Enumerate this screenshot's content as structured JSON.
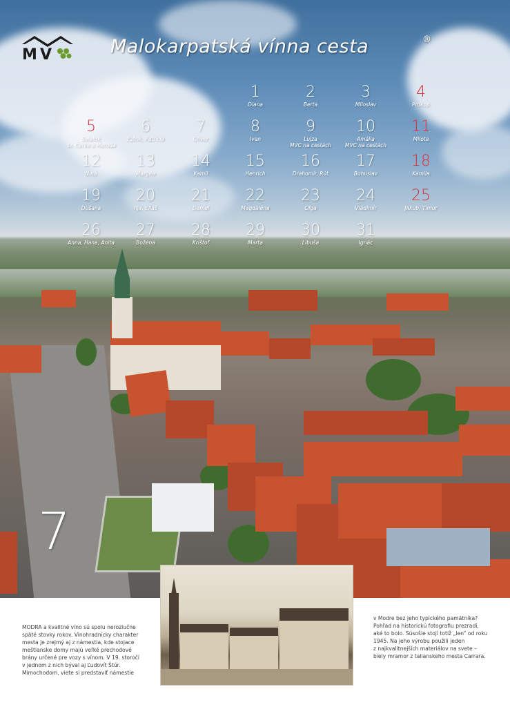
{
  "header": {
    "logo_text": "MVC",
    "title": "Malokarpatská vínna cesta",
    "registered": "®"
  },
  "calendar": {
    "month_number": "7",
    "days": [
      {
        "num": "1",
        "name": "Diana",
        "holiday": false
      },
      {
        "num": "2",
        "name": "Berta",
        "holiday": false
      },
      {
        "num": "3",
        "name": "Miloslav",
        "holiday": false
      },
      {
        "num": "4",
        "name": "Prokop",
        "holiday": true
      },
      {
        "num": "5",
        "name": "Sviatok",
        "name2": "sv. Cyrila a Metoda",
        "holiday": true
      },
      {
        "num": "6",
        "name": "Patrik, Patrícia",
        "holiday": false
      },
      {
        "num": "7",
        "name": "Oliver",
        "holiday": false
      },
      {
        "num": "8",
        "name": "Ivan",
        "holiday": false
      },
      {
        "num": "9",
        "name": "Lujza",
        "name2": "MVC na cestách",
        "holiday": false
      },
      {
        "num": "10",
        "name": "Amália",
        "name2": "MVC na cestách",
        "holiday": false
      },
      {
        "num": "11",
        "name": "Milota",
        "holiday": true
      },
      {
        "num": "12",
        "name": "Nina",
        "holiday": false
      },
      {
        "num": "13",
        "name": "Margita",
        "holiday": false
      },
      {
        "num": "14",
        "name": "Kamil",
        "holiday": false
      },
      {
        "num": "15",
        "name": "Henrich",
        "holiday": false
      },
      {
        "num": "16",
        "name": "Drahomír, Rút",
        "holiday": false
      },
      {
        "num": "17",
        "name": "Bohuslav",
        "holiday": false
      },
      {
        "num": "18",
        "name": "Kamila",
        "holiday": true
      },
      {
        "num": "19",
        "name": "Dušana",
        "holiday": false
      },
      {
        "num": "20",
        "name": "Iľja, Eliáš",
        "holiday": false
      },
      {
        "num": "21",
        "name": "Daniel",
        "holiday": false
      },
      {
        "num": "22",
        "name": "Magdaléna",
        "holiday": false
      },
      {
        "num": "23",
        "name": "Oľga",
        "holiday": false
      },
      {
        "num": "24",
        "name": "Vladimír",
        "holiday": false
      },
      {
        "num": "25",
        "name": "Jakub, Timur",
        "holiday": true
      },
      {
        "num": "26",
        "name": "Anna, Hana, Anita",
        "holiday": false
      },
      {
        "num": "27",
        "name": "Božena",
        "holiday": false
      },
      {
        "num": "28",
        "name": "Krištof",
        "holiday": false
      },
      {
        "num": "29",
        "name": "Marta",
        "holiday": false
      },
      {
        "num": "30",
        "name": "Libuša",
        "holiday": false
      },
      {
        "num": "31",
        "name": "Ignác",
        "holiday": false
      }
    ]
  },
  "text": {
    "left": [
      "MODRA a kvalitné víno sú spolu nerozlučne",
      "späté stovky rokov. Vinohradnícky charakter",
      "mesta je zrejmý aj z námestia, kde stojace",
      "meštianske domy majú veľké prechodové",
      "brány určené pre vozy s vínom. V 19. storočí",
      "v jednom z nich býval aj Ľudovít Štúr.",
      "Mimochodom, viete si predstaviť námestie"
    ],
    "right": [
      "v Modre bez jeho typického pamätníka?",
      "Pohľad na historickú fotografiu prezradí,",
      "aké to bolo. Súsošie stojí totiž „len“ od roku",
      "1945. Na jeho výrobu použili jeden",
      "z najkvalitnejších materiálov na svete –",
      "biely mramor z talianskeho mesta Carrara."
    ]
  },
  "colors": {
    "holiday_red": "#d8323a",
    "text_white": "#ffffff",
    "body_text": "#3c3c3c"
  }
}
